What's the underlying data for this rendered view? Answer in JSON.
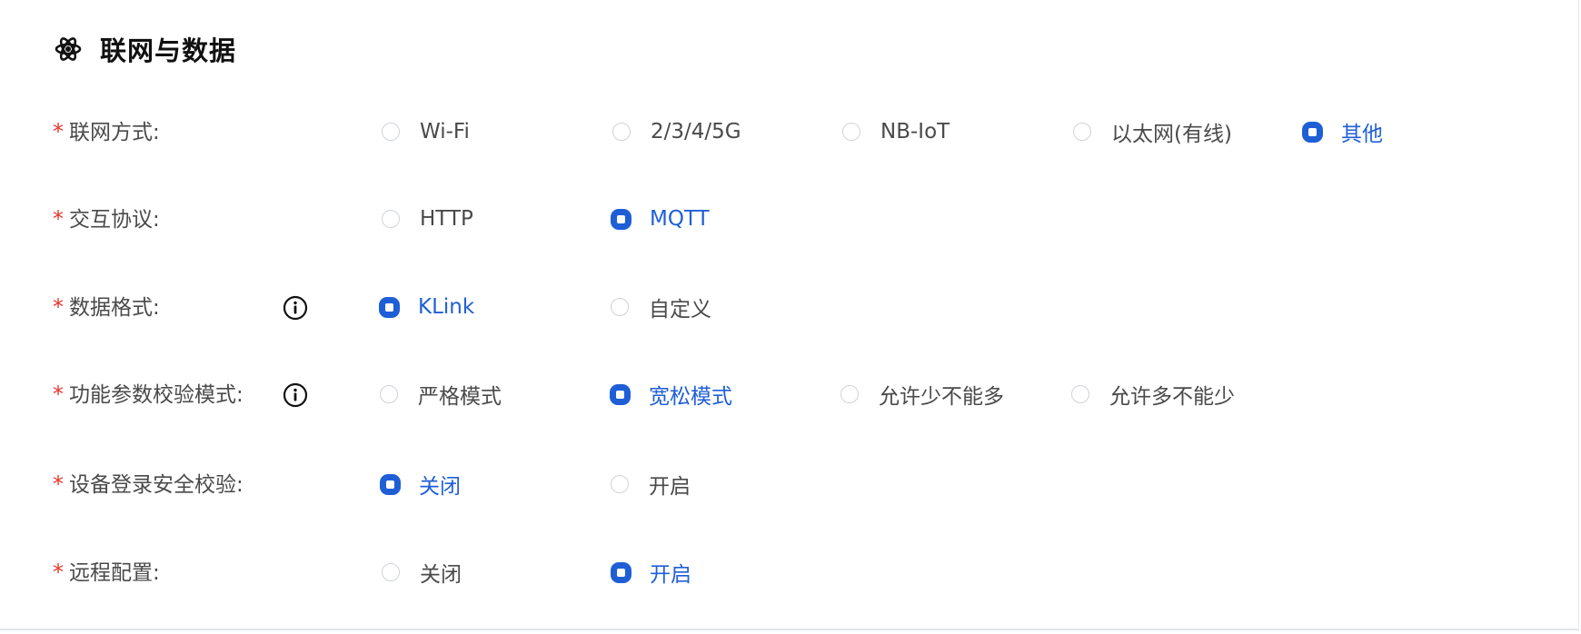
{
  "section": {
    "title": "联网与数据",
    "icon": "atom-icon"
  },
  "theme": {
    "accent": "#1f5fd6",
    "required": "#e5352b"
  },
  "rows": [
    {
      "label": "联网方式:",
      "required_mark": "*",
      "options": [
        {
          "label": "Wi-Fi",
          "checked": false
        },
        {
          "label": "2/3/4/5G",
          "checked": false
        },
        {
          "label": "NB-IoT",
          "checked": false
        },
        {
          "label": "以太网(有线)",
          "checked": false
        },
        {
          "label": "其他",
          "checked": true
        }
      ]
    },
    {
      "label": "交互协议:",
      "required_mark": "*",
      "options": [
        {
          "label": "HTTP",
          "checked": false
        },
        {
          "label": "MQTT",
          "checked": true
        }
      ]
    },
    {
      "label": "数据格式:",
      "required_mark": "*",
      "info_icon": "info-circle-icon",
      "options": [
        {
          "label": "KLink",
          "checked": true
        },
        {
          "label": "自定义",
          "checked": false
        }
      ]
    },
    {
      "label": "功能参数校验模式:",
      "required_mark": "*",
      "info_icon": "info-circle-icon",
      "options": [
        {
          "label": "严格模式",
          "checked": false
        },
        {
          "label": "宽松模式",
          "checked": true
        },
        {
          "label": "允许少不能多",
          "checked": false
        },
        {
          "label": "允许多不能少",
          "checked": false
        }
      ]
    },
    {
      "label": "设备登录安全校验:",
      "required_mark": "*",
      "options": [
        {
          "label": "关闭",
          "checked": true
        },
        {
          "label": "开启",
          "checked": false
        }
      ]
    },
    {
      "label": "远程配置:",
      "required_mark": "*",
      "options": [
        {
          "label": "关闭",
          "checked": false
        },
        {
          "label": "开启",
          "checked": true
        }
      ]
    }
  ]
}
